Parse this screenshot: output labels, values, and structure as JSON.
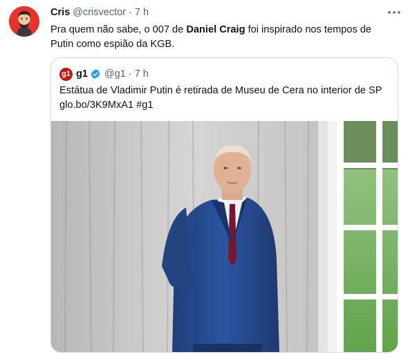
{
  "tweet": {
    "author_name": "Cris",
    "author_handle": "@crisvector",
    "separator": "·",
    "time": "7 h",
    "more_icon": "more-dots-icon",
    "text_before": "Pra quem não sabe, o 007 de ",
    "text_bold": "Daniel Craig",
    "text_after": " foi inspirado nos tempos de Putin como espião da KGB."
  },
  "quoted": {
    "logo_text": "g1",
    "author_name": "g1",
    "verified_icon": "verified-badge-icon",
    "author_handle": "@g1",
    "separator": "·",
    "time": "7 h",
    "text_line1": "Estátua de Vladimir Putin é retirada de Museu de Cera no interior de SP",
    "text_line2": "glo.bo/3K9MxA1 #g1"
  },
  "colors": {
    "avatar_bg": "#e8322b",
    "g1_red": "#c4170c",
    "verified_blue": "#1d9bf0",
    "muted_text": "#536471"
  }
}
